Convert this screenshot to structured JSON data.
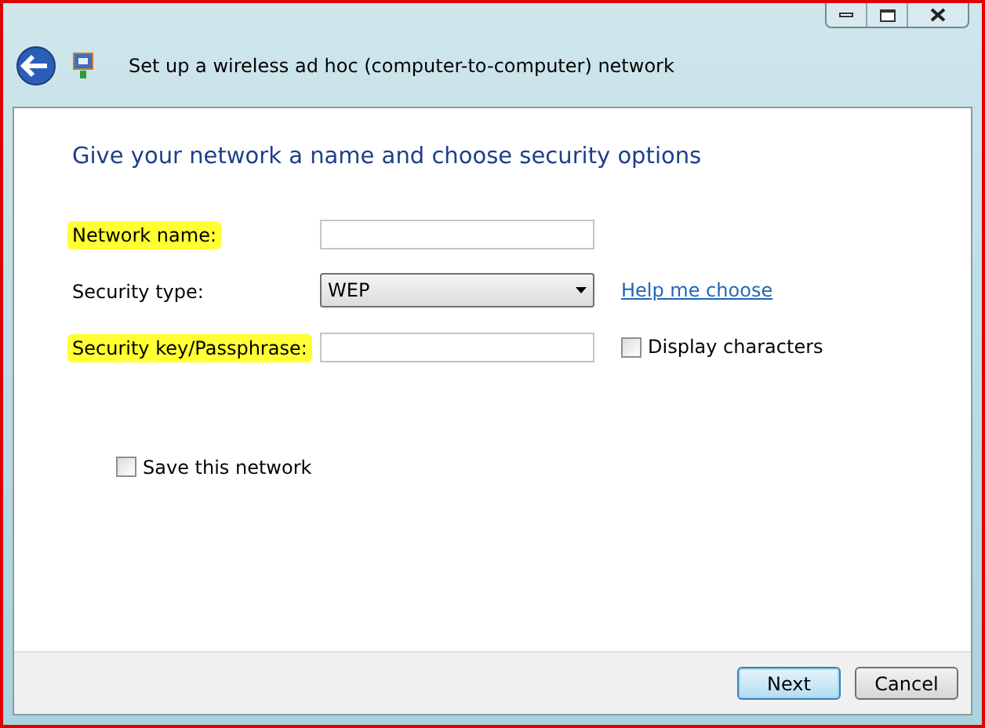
{
  "window": {
    "title": "Set up a wireless ad hoc (computer-to-computer) network"
  },
  "heading": "Give your network a name and choose security options",
  "fields": [
    {
      "kind": "text",
      "label": "Network name:",
      "highlighted": true
    },
    {
      "kind": "select",
      "label": "Security type:",
      "highlighted": false,
      "value": "WEP",
      "link": "Help me choose"
    },
    {
      "kind": "text",
      "label": "Security key/Passphrase:",
      "highlighted": true,
      "option": {
        "label": "Display characters",
        "checked": false
      }
    }
  ],
  "save_option": {
    "label": "Save this network",
    "checked": false
  },
  "buttons": [
    {
      "label": "Next",
      "default": true
    },
    {
      "label": "Cancel",
      "default": false
    }
  ]
}
